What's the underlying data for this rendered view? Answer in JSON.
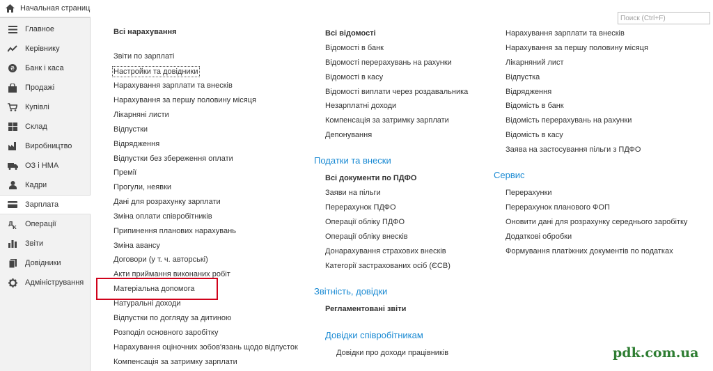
{
  "home": {
    "label": "Начальная страница",
    "icon": "home-icon"
  },
  "search": {
    "placeholder": "Поиск (Ctrl+F)",
    "value": ""
  },
  "sidebar": {
    "items": [
      {
        "label": "Главное",
        "icon": "menu-lines-icon"
      },
      {
        "label": "Керівнику",
        "icon": "trend-chart-icon"
      },
      {
        "label": "Банк і каса",
        "icon": "coin-icon"
      },
      {
        "label": "Продажі",
        "icon": "shopping-bag-icon"
      },
      {
        "label": "Купівлі",
        "icon": "cart-icon"
      },
      {
        "label": "Склад",
        "icon": "warehouse-grid-icon"
      },
      {
        "label": "Виробництво",
        "icon": "factory-icon"
      },
      {
        "label": "ОЗ і НМА",
        "icon": "truck-icon"
      },
      {
        "label": "Кадри",
        "icon": "person-icon"
      },
      {
        "label": "Зарплата",
        "icon": "wallet-icon"
      },
      {
        "label": "Операції",
        "icon": "operations-icon"
      },
      {
        "label": "Звіти",
        "icon": "bar-chart-icon"
      },
      {
        "label": "Довідники",
        "icon": "book-icon"
      },
      {
        "label": "Адміністрування",
        "icon": "gear-icon"
      }
    ],
    "active_index": 9
  },
  "col1": {
    "header": "Всі нарахування",
    "items": [
      "Звіти по зарплаті",
      "Настройки та довідники",
      "Нарахування зарплати та внесків",
      "Нарахування за першу половину місяця",
      "Лікарняні листи",
      "Відпустки",
      "Відрядження",
      "Відпустки без збереження оплати",
      "Премії",
      "Прогули, неявки",
      "Дані для розрахунку зарплати",
      "Зміна оплати співробітників",
      "Припинення планових нарахувань",
      "Зміна авансу",
      "Договори (у т. ч. авторські)",
      "Акти приймання виконаних робіт",
      "Матеріальна допомога",
      "Натуральні доходи",
      "Відпустки по догляду за дитиною",
      "Розподіл основного заробітку",
      "Нарахування оціночних зобов'язань щодо відпусток",
      "Компенсація за затримку зарплати"
    ]
  },
  "col2": {
    "header": "Всі відомості",
    "items": [
      "Відомості в банк",
      "Відомості перерахувань на рахунки",
      "Відомості в касу",
      "Відомості виплати через роздавальника",
      "Незарплатні доходи",
      "Компенсація за затримку зарплати",
      "Депонування"
    ],
    "taxes": {
      "title": "Податки та внески",
      "header": "Всі документи по ПДФО",
      "items": [
        "Заяви на пільги",
        "Перерахунок ПДФО",
        "Операції обліку ПДФО",
        "Операції обліку внесків",
        "Донарахування страхових внесків",
        "Категорії застрахованих осіб (ЄСВ)"
      ]
    },
    "reports": {
      "title": "Звітність, довідки",
      "header": "Регламентовані звіти"
    },
    "employee_refs": {
      "title": "Довідки співробітникам",
      "items": [
        "Довідки про доходи працівників"
      ]
    }
  },
  "col3": {
    "items": [
      "Нарахування зарплати та внесків",
      "Нарахування за першу половину місяця",
      "Лікарняний лист",
      "Відпустка",
      "Відрядження",
      "Відомість в банк",
      "Відомість перерахувань на рахунки",
      "Відомість в касу",
      "Заява на застосування пільги з ПДФО"
    ],
    "service": {
      "title": "Сервис",
      "items": [
        "Перерахунки",
        "Перерахунок планового ФОП",
        "Оновити дані для розрахунку середнього заробітку",
        "Додаткові обробки",
        "Формування платіжних документів по податках"
      ]
    }
  },
  "watermark": "pdk.com.ua",
  "colors": {
    "accent": "#1a8ad3",
    "highlight": "#d0021b",
    "watermark": "#2e7d32"
  }
}
